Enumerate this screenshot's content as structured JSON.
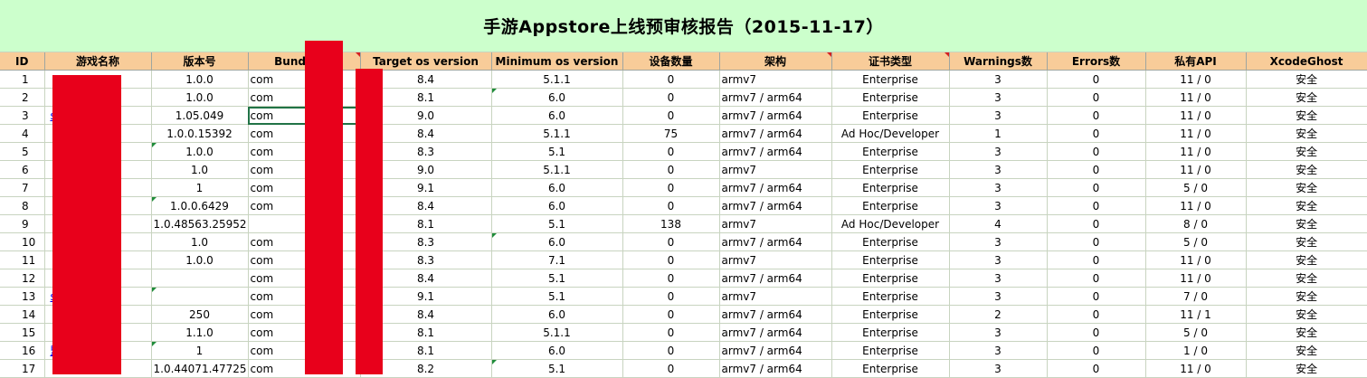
{
  "title": "手游Appstore上线预审核报告（2015-11-17）",
  "headers": [
    "ID",
    "游戏名称",
    "版本号",
    "Bundle ID",
    "Target os version",
    "Minimum os version",
    "设备数量",
    "架构",
    "证书类型",
    "Warnings数",
    "Errors数",
    "私有API",
    "XcodeGhost"
  ],
  "rows": [
    {
      "id": "1",
      "name": "",
      "version": "1.0.0",
      "bundle": "com",
      "target": "8.4",
      "min": "5.1.1",
      "devices": "0",
      "arch": "armv7",
      "cert": "Enterprise",
      "warnings": "3",
      "errors": "0",
      "api": "11 / 0",
      "xcode": "安全"
    },
    {
      "id": "2",
      "name": "",
      "version": "1.0.0",
      "bundle": "com",
      "target": "8.1",
      "min": "6.0",
      "devices": "0",
      "arch": "armv7 / arm64",
      "cert": "Enterprise",
      "warnings": "3",
      "errors": "0",
      "api": "11 / 0",
      "xcode": "安全"
    },
    {
      "id": "3",
      "name": "s",
      "version": "1.05.049",
      "bundle": "com",
      "target": "9.0",
      "min": "6.0",
      "devices": "0",
      "arch": "armv7 / arm64",
      "cert": "Enterprise",
      "warnings": "3",
      "errors": "0",
      "api": "11 / 0",
      "xcode": "安全"
    },
    {
      "id": "4",
      "name": "",
      "version": "1.0.0.15392",
      "bundle": "com",
      "target": "8.4",
      "min": "5.1.1",
      "devices": "75",
      "arch": "armv7 / arm64",
      "cert": "Ad Hoc/Developer",
      "warnings": "1",
      "errors": "0",
      "api": "11 / 0",
      "xcode": "安全"
    },
    {
      "id": "5",
      "name": "",
      "version": "1.0.0",
      "bundle": "com",
      "target": "8.3",
      "min": "5.1",
      "devices": "0",
      "arch": "armv7 / arm64",
      "cert": "Enterprise",
      "warnings": "3",
      "errors": "0",
      "api": "11 / 0",
      "xcode": "安全"
    },
    {
      "id": "6",
      "name": "",
      "version": "1.0",
      "bundle": "com",
      "target": "9.0",
      "min": "5.1.1",
      "devices": "0",
      "arch": "armv7",
      "cert": "Enterprise",
      "warnings": "3",
      "errors": "0",
      "api": "11 / 0",
      "xcode": "安全"
    },
    {
      "id": "7",
      "name": "",
      "version": "1",
      "bundle": "com",
      "target": "9.1",
      "min": "6.0",
      "devices": "0",
      "arch": "armv7 / arm64",
      "cert": "Enterprise",
      "warnings": "3",
      "errors": "0",
      "api": "5 / 0",
      "xcode": "安全"
    },
    {
      "id": "8",
      "name": "",
      "version": "1.0.0.6429",
      "bundle": "com",
      "target": "8.4",
      "min": "6.0",
      "devices": "0",
      "arch": "armv7 / arm64",
      "cert": "Enterprise",
      "warnings": "3",
      "errors": "0",
      "api": "11 / 0",
      "xcode": "安全"
    },
    {
      "id": "9",
      "name": "",
      "version": "1.0.48563.25952",
      "bundle": "",
      "target": "8.1",
      "min": "5.1",
      "devices": "138",
      "arch": "armv7",
      "cert": "Ad Hoc/Developer",
      "warnings": "4",
      "errors": "0",
      "api": "8 / 0",
      "xcode": "安全"
    },
    {
      "id": "10",
      "name": "",
      "version": "1.0",
      "bundle": "com",
      "target": "8.3",
      "min": "6.0",
      "devices": "0",
      "arch": "armv7 / arm64",
      "cert": "Enterprise",
      "warnings": "3",
      "errors": "0",
      "api": "5 / 0",
      "xcode": "安全"
    },
    {
      "id": "11",
      "name": "",
      "version": "1.0.0",
      "bundle": "com",
      "target": "8.3",
      "min": "7.1",
      "devices": "0",
      "arch": "armv7",
      "cert": "Enterprise",
      "warnings": "3",
      "errors": "0",
      "api": "11 / 0",
      "xcode": "安全"
    },
    {
      "id": "12",
      "name": "",
      "version": "",
      "bundle": "com",
      "target": "8.4",
      "min": "5.1",
      "devices": "0",
      "arch": "armv7 / arm64",
      "cert": "Enterprise",
      "warnings": "3",
      "errors": "0",
      "api": "11 / 0",
      "xcode": "安全"
    },
    {
      "id": "13",
      "name": "s",
      "version": "",
      "bundle": "com",
      "target": "9.1",
      "min": "5.1",
      "devices": "0",
      "arch": "armv7",
      "cert": "Enterprise",
      "warnings": "3",
      "errors": "0",
      "api": "7 / 0",
      "xcode": "安全"
    },
    {
      "id": "14",
      "name": "",
      "version": "250",
      "bundle": "com",
      "target": "8.4",
      "min": "6.0",
      "devices": "0",
      "arch": "armv7 / arm64",
      "cert": "Enterprise",
      "warnings": "2",
      "errors": "0",
      "api": "11 / 1",
      "xcode": "安全"
    },
    {
      "id": "15",
      "name": "",
      "version": "1.1.0",
      "bundle": "com",
      "target": "8.1",
      "min": "5.1.1",
      "devices": "0",
      "arch": "armv7 / arm64",
      "cert": "Enterprise",
      "warnings": "3",
      "errors": "0",
      "api": "5 / 0",
      "xcode": "安全"
    },
    {
      "id": "16",
      "name": "盟",
      "version": "1",
      "bundle": "com",
      "target": "8.1",
      "min": "6.0",
      "devices": "0",
      "arch": "armv7 / arm64",
      "cert": "Enterprise",
      "warnings": "3",
      "errors": "0",
      "api": "1 / 0",
      "xcode": "安全"
    },
    {
      "id": "17",
      "name": "",
      "version": "1.0.44071.47725",
      "bundle": "com",
      "target": "8.2",
      "min": "5.1",
      "devices": "0",
      "arch": "armv7 / arm64",
      "cert": "Enterprise",
      "warnings": "3",
      "errors": "0",
      "api": "11 / 0",
      "xcode": "安全"
    }
  ],
  "colors": {
    "title_bg": "#ccffcc",
    "header_bg": "#f8cc99",
    "redaction": "#e8001b",
    "selection": "#217346"
  }
}
